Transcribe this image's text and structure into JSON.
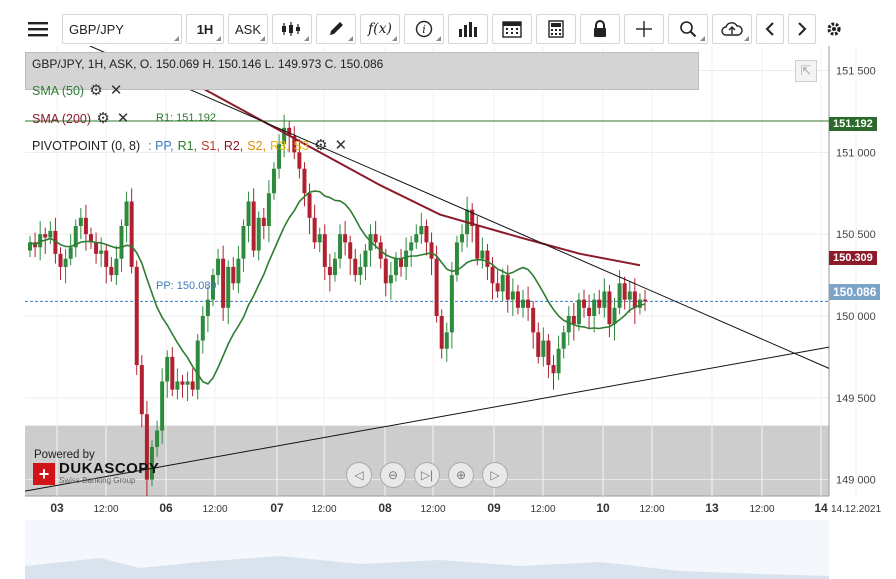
{
  "toolbar": {
    "symbol": "GBP/JPY",
    "timeframe": "1H",
    "side": "ASK",
    "icons": [
      "menu-icon",
      "candlestick-icon",
      "pencil-icon",
      "function-icon",
      "info-icon",
      "bar-chart-icon",
      "calendar-icon",
      "calculator-icon",
      "lock-icon",
      "crosshair-icon",
      "zoom-icon",
      "cloud-upload-icon",
      "chevron-left-icon",
      "chevron-right-icon",
      "gear-icon"
    ]
  },
  "legend": {
    "info": "GBP/JPY, 1H, ASK,  O. 150.069 H. 150.146 L. 149.973 C. 150.086",
    "sma50": "SMA (50)",
    "sma200": "SMA (200)",
    "pivot": "PIVOTPOINT (0, 8)",
    "pivot_parts": [
      ": PP,",
      "R1,",
      "S1,",
      "R2,",
      "S2,",
      "R3,",
      "S3"
    ],
    "r1_label": "R1: 151.192",
    "pp_label": "PP: 150.089"
  },
  "branding": {
    "powered": "Powered by",
    "logo": "DUKASCOPY",
    "logo_sub": "Swiss Banking Group"
  },
  "colors": {
    "sma50": "#2e7d32",
    "sma200": "#8b1a2b",
    "pp": "#3d7bbf",
    "r1": "#2b7a2b",
    "s1": "#c0392b",
    "r2": "#c0392b",
    "s2": "#e08a00",
    "r3": "#f0b400",
    "s3": "#f0b400",
    "bull": "#2e8b3e",
    "bear": "#b02030"
  },
  "price_tags": {
    "r1": "151.192",
    "sma200": "150.309",
    "last": "150.086"
  },
  "chart_data": {
    "type": "candlestick",
    "title": "GBP/JPY, 1H, ASK",
    "ylim": [
      148.9,
      151.65
    ],
    "yticks": [
      "151.500",
      "151.000",
      "150.500",
      "150.000",
      "149.500",
      "149.000"
    ],
    "ytick_values": [
      151.5,
      151.0,
      150.5,
      150.0,
      149.5,
      149.0
    ],
    "xticks": [
      {
        "label": "03",
        "major": true
      },
      {
        "label": "12:00",
        "major": false
      },
      {
        "label": "06",
        "major": true
      },
      {
        "label": "12:00",
        "major": false
      },
      {
        "label": "07",
        "major": true
      },
      {
        "label": "12:00",
        "major": false
      },
      {
        "label": "08",
        "major": true
      },
      {
        "label": "12:00",
        "major": false
      },
      {
        "label": "09",
        "major": true
      },
      {
        "label": "12:00",
        "major": false
      },
      {
        "label": "10",
        "major": true
      },
      {
        "label": "12:00",
        "major": false
      },
      {
        "label": "13",
        "major": true
      },
      {
        "label": "12:00",
        "major": false
      },
      {
        "label": "14",
        "major": true
      },
      {
        "label": "14.12.2021",
        "major": false
      }
    ],
    "levels": {
      "pp": 150.089,
      "r1": 151.192
    },
    "candles_close": [
      150.45,
      150.42,
      150.5,
      150.48,
      150.52,
      150.38,
      150.3,
      150.35,
      150.42,
      150.55,
      150.6,
      150.5,
      150.45,
      150.38,
      150.4,
      150.3,
      150.25,
      150.35,
      150.55,
      150.7,
      150.3,
      149.7,
      149.4,
      149.0,
      149.2,
      149.3,
      149.6,
      149.75,
      149.55,
      149.6,
      149.58,
      149.6,
      149.55,
      149.85,
      150.0,
      150.1,
      150.25,
      150.35,
      150.05,
      150.3,
      150.2,
      150.35,
      150.55,
      150.7,
      150.4,
      150.6,
      150.55,
      150.75,
      150.9,
      151.05,
      151.15,
      151.1,
      151.0,
      150.9,
      150.75,
      150.6,
      150.45,
      150.5,
      150.3,
      150.25,
      150.35,
      150.5,
      150.45,
      150.35,
      150.25,
      150.3,
      150.4,
      150.5,
      150.45,
      150.35,
      150.2,
      150.25,
      150.35,
      150.3,
      150.4,
      150.45,
      150.5,
      150.55,
      150.45,
      150.35,
      150.0,
      149.8,
      149.9,
      150.25,
      150.45,
      150.5,
      150.65,
      150.55,
      150.35,
      150.4,
      150.3,
      150.2,
      150.15,
      150.25,
      150.1,
      150.15,
      150.05,
      150.1,
      150.05,
      149.9,
      149.75,
      149.85,
      149.7,
      149.65,
      149.8,
      149.9,
      150.0,
      149.95,
      150.1,
      150.05,
      150.0,
      150.1,
      150.05,
      150.15,
      149.95,
      150.05,
      150.2,
      150.1,
      150.15,
      150.05,
      150.1,
      150.09
    ]
  }
}
